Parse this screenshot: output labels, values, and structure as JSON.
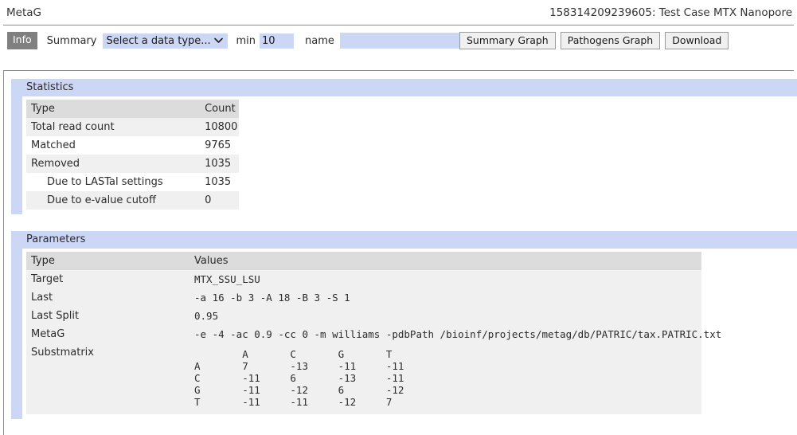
{
  "header": {
    "app_title": "MetaG",
    "run_title": "158314209239605: Test Case MTX Nanopore"
  },
  "toolbar": {
    "info_label": "Info",
    "summary_label": "Summary",
    "data_type_selected": "Select a data type...",
    "chevron_icon": "chevron-down-icon",
    "min_label": "min",
    "min_value": "10",
    "name_label": "name",
    "name_value": "",
    "name_placeholder": "",
    "summary_graph_label": "Summary Graph",
    "pathogens_graph_label": "Pathogens Graph",
    "download_label": "Download"
  },
  "statistics": {
    "panel_title": "Statistics",
    "columns": [
      "Type",
      "Count"
    ],
    "rows": [
      {
        "type": "Total read count",
        "count": "10800",
        "indent": false
      },
      {
        "type": "Matched",
        "count": "9765",
        "indent": false
      },
      {
        "type": "Removed",
        "count": "1035",
        "indent": false
      },
      {
        "type": "Due to LASTal settings",
        "count": "1035",
        "indent": true
      },
      {
        "type": "Due to e-value cutoff",
        "count": "0",
        "indent": true
      }
    ]
  },
  "parameters": {
    "panel_title": "Parameters",
    "columns": [
      "Type",
      "Values"
    ],
    "rows": [
      {
        "type": "Target",
        "value": "MTX_SSU_LSU"
      },
      {
        "type": "Last",
        "value": "-a 16 -b 3 -A 18 -B 3 -S 1"
      },
      {
        "type": "Last Split",
        "value": "0.95"
      },
      {
        "type": "MetaG",
        "value": "-e -4 -ac 0.9 -cc 0 -m williams -pdbPath /bioinf/projects/metag/db/PATRIC/tax.PATRIC.txt"
      }
    ],
    "substmatrix": {
      "type": "Substmatrix",
      "value": "        A       C       G       T\nA       7       -13     -11     -11\nC       -11     6       -13     -11\nG       -11     -12     6       -12\nT       -11     -11     -12     7"
    }
  },
  "colors": {
    "panel_accent": "#ccd6f5",
    "input_background": "#ccd6f5",
    "info_button": "#808080",
    "table_header": "#dcdcdc",
    "table_row": "#f0f0f0"
  }
}
